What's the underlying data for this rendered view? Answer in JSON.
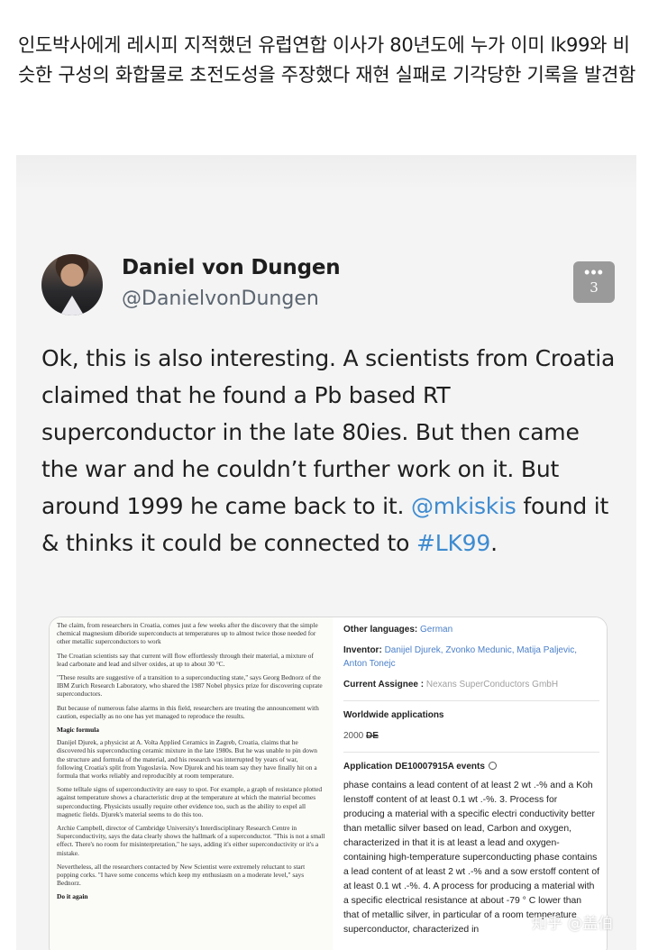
{
  "post": {
    "title": "인도박사에게 레시피 지적했던 유럽연합 이사가 80년도에 누가 이미 lk99와 비슷한 구성의 화합물로 초전도성을 주장했다 재현 실패로 기각당한 기록을 발견함"
  },
  "tweet": {
    "author_name": "Daniel von Dungen",
    "author_handle": "@DanielvonDungen",
    "more_count": "3",
    "text_1": "Ok, this is also interesting. A scientists from Croatia claimed that he found a Pb based RT superconductor in the late 80ies. But then came the war and he couldn’t further work on it. But around 1999 he came back to it. ",
    "mention": "@mkiskis",
    "text_2": " found it & thinks it could be connected to ",
    "hashtag": "#LK99",
    "text_3": "."
  },
  "news_article": {
    "p1": "The claim, from researchers in Croatia, comes just a few weeks after the discovery that the simple chemical magnesium diboride superconducts at temperatures up to almost twice those needed for other metallic superconductors to work",
    "p2": "The Croatian scientists say that current will flow effortlessly through their material, a mixture of lead carbonate and lead and silver oxides, at up to about 30 °C.",
    "p3": "\"These results are suggestive of a transition to a superconducting state,\" says Georg Bednorz of the IBM Zurich Research Laboratory, who shared the 1987 Nobel physics prize for discovering cuprate superconductors.",
    "p4": "But because of numerous false alarms in this field, researchers are treating the announcement with caution, especially as no one has yet managed to reproduce the results.",
    "h1": "Magic formula",
    "p5": "Danijel Djurek, a physicist at A. Volta Applied Ceramics in Zagreb, Croatia, claims that he discovered his superconducting ceramic mixture in the late 1980s. But he was unable to pin down the structure and formula of the material, and his research was interrupted by years of war, following Croatia's split from Yugoslavia. Now Djurek and his team say they have finally hit on a formula that works reliably and reproducibly at room temperature.",
    "p6": "Some telltale signs of superconductivity are easy to spot. For example, a graph of resistance plotted against temperature shows a characteristic drop at the temperature at which the material becomes superconducting. Physicists usually require other evidence too, such as the ability to expel all magnetic fields. Djurek's material seems to do this too.",
    "p7": "Archie Campbell, director of Cambridge University's Interdisciplinary Research Centre in Superconductivity, says the data clearly shows the hallmark of a superconductor. \"This is not a small effect. There's no room for misinterpretation,\" he says, adding it's either superconductivity or it's a mistake.",
    "p8": "Nevertheless, all the researchers contacted by New Scientist were extremely reluctant to start popping corks. \"I have some concerns which keep my enthusiasm on a moderate level,\" says Bednorz.",
    "h2": "Do it again"
  },
  "patent": {
    "other_languages_label": "Other languages:",
    "other_languages_value": "German",
    "inventor_label": "Inventor:",
    "inventors": "Danijel Djurek, Zvonko Medunic, Matija Paljevic, Anton Tonejc",
    "assignee_label": "Current Assignee :",
    "assignee_value": "Nexans SuperConductors GmbH",
    "worldwide_label": "Worldwide applications",
    "year": "2000",
    "country": "DE",
    "events_label": "Application DE10007915A events",
    "claims": "phase contains a lead content of at least 2 wt .-% and a Koh lenstoff content of at least 0.1 wt .-%. 3. Process for producing a material with a specific electri conductivity better than metallic silver based on lead, Carbon and oxygen, characterized in that it is at least a lead and oxygen-containing high-temperature superconducting phase contains a lead content of at least 2 wt .-% and a sow erstoff content of at least 0.1 wt .-%. 4. A process for producing a material with a specific electrical resistance at about -79 ° C lower than that of metallic silver, in particular of a room temperature superconductor, characterized in"
  },
  "watermark": "知乎 @盖伯"
}
